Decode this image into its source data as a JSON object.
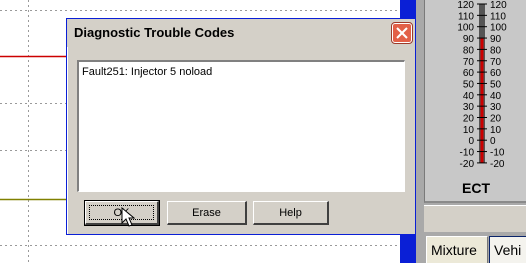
{
  "dialog": {
    "title": "Diagnostic Trouble Codes",
    "codes": [
      "Fault251: Injector 5 noload"
    ],
    "buttons": {
      "ok": "OK",
      "erase": "Erase",
      "help": "Help"
    }
  },
  "gauge": {
    "label": "ECT",
    "ticks": [
      120,
      110,
      100,
      90,
      80,
      70,
      60,
      50,
      40,
      30,
      20,
      10,
      0,
      -10,
      -20
    ],
    "min": -20,
    "max": 120,
    "value": 90,
    "indicator_color": "#cc0000"
  },
  "tabs": {
    "mixture": "Mixture",
    "vehicle": "Vehi"
  },
  "colors": {
    "trace_red": "#cc0000",
    "trace_olive": "#808000",
    "strip_blue": "#0a1fd6"
  }
}
